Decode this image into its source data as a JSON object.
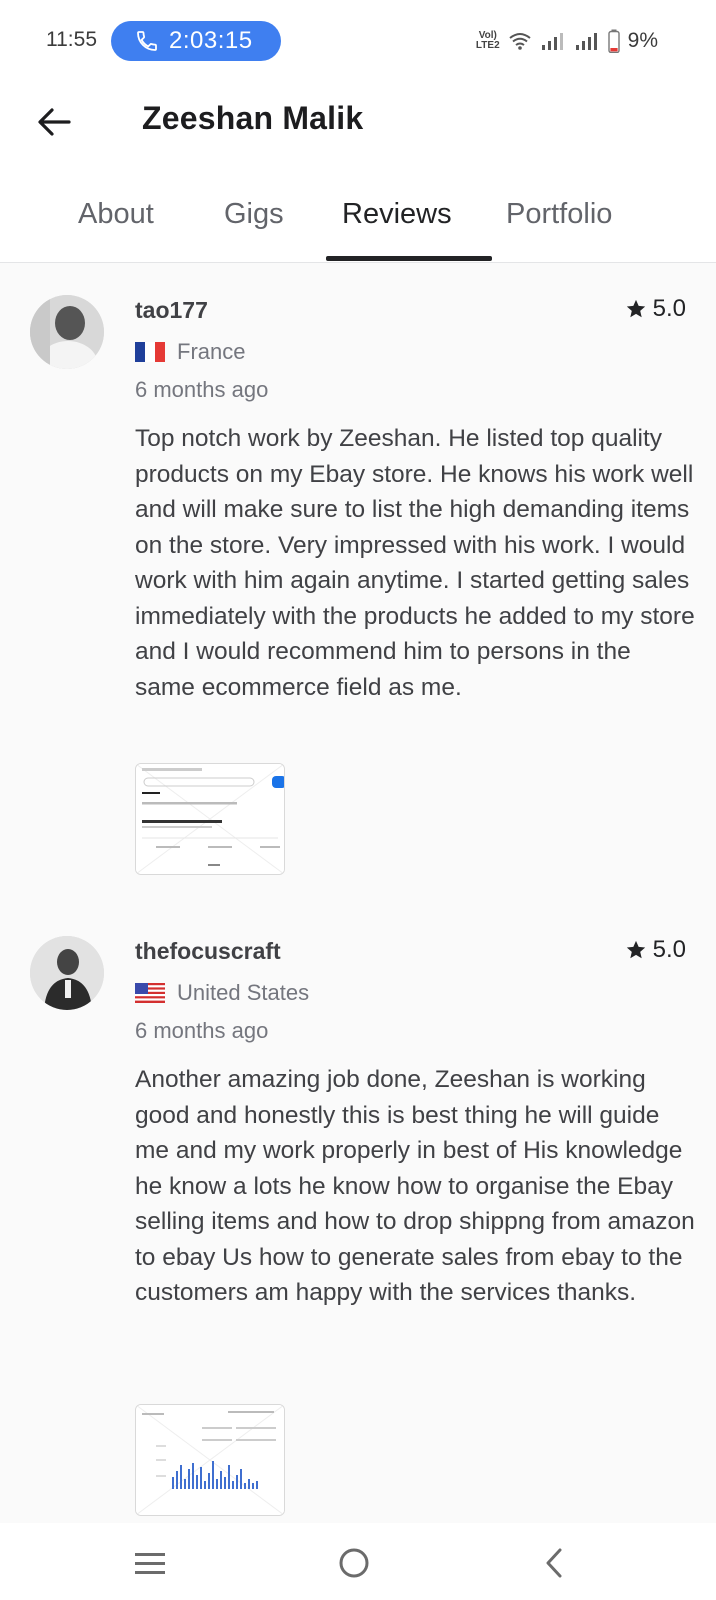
{
  "status_bar": {
    "time": "11:55",
    "call_timer": "2:03:15",
    "network_label_top": "Vol)",
    "network_label_bottom": "LTE2",
    "battery": "9%"
  },
  "header": {
    "title": "Zeeshan Malik",
    "back_icon": "arrow-left-icon"
  },
  "tabs": [
    {
      "label": "About",
      "active": false
    },
    {
      "label": "Gigs",
      "active": false
    },
    {
      "label": "Reviews",
      "active": true
    },
    {
      "label": "Portfolio",
      "active": false
    }
  ],
  "reviews": [
    {
      "username": "tao177",
      "rating": "5.0",
      "country": "France",
      "time_ago": "6 months ago",
      "text": "Top notch work by Zeeshan. He listed top quality products on my Ebay store. He knows his work well and will make sure to list the high demanding items on the store. Very impressed with his work.  I would work with him again anytime. I started getting sales immediately with the products he added to my store and I would recommend him to persons in the same ecommerce field as me."
    },
    {
      "username": "thefocuscraft",
      "rating": "5.0",
      "country": "United States",
      "time_ago": "6 months ago",
      "text": "Another amazing job done, Zeeshan is working good and honestly this is best thing he will guide me and my work properly in best of His knowledge he know a lots he know how to organise the Ebay selling items and how to drop shippng from amazon to ebay Us how to generate sales from ebay to the customers am happy with the services thanks."
    }
  ],
  "nav_bar": {
    "icons": [
      "recent-apps-icon",
      "home-icon",
      "back-icon"
    ]
  },
  "colors": {
    "accent_call": "#3f7ff0",
    "battery_low": "#e53935",
    "text_primary": "#222325",
    "text_secondary": "#74767e"
  }
}
